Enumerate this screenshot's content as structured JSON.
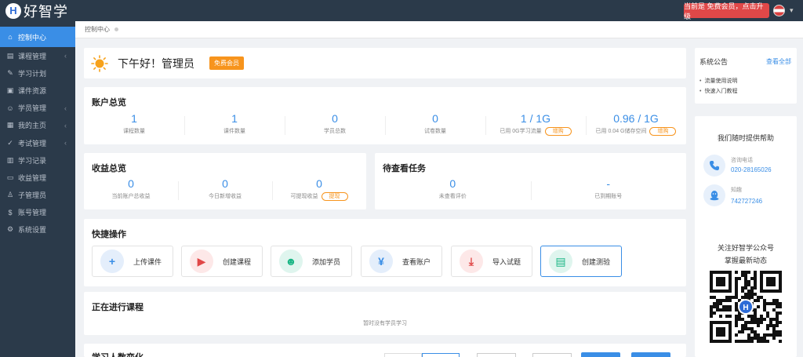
{
  "app": {
    "logo_mark": "H",
    "logo_text": "好智学",
    "upgrade_label": "当前是 免费会员，点击升级",
    "user_caret": "▾"
  },
  "sidebar": {
    "items": [
      {
        "label": "控制中心",
        "icon": "home-icon",
        "glyph": "⌂",
        "arrow": ""
      },
      {
        "label": "课程管理",
        "icon": "course-icon",
        "glyph": "▤",
        "arrow": "‹"
      },
      {
        "label": "学习计划",
        "icon": "plan-icon",
        "glyph": "✎",
        "arrow": ""
      },
      {
        "label": "课件资源",
        "icon": "resource-icon",
        "glyph": "▣",
        "arrow": ""
      },
      {
        "label": "学员管理",
        "icon": "students-icon",
        "glyph": "☺",
        "arrow": "‹"
      },
      {
        "label": "我的主页",
        "icon": "homepage-icon",
        "glyph": "▦",
        "arrow": "‹"
      },
      {
        "label": "考试管理",
        "icon": "exam-icon",
        "glyph": "✓",
        "arrow": "‹"
      },
      {
        "label": "学习记录",
        "icon": "record-icon",
        "glyph": "▥",
        "arrow": ""
      },
      {
        "label": "收益管理",
        "icon": "income-icon",
        "glyph": "▭",
        "arrow": ""
      },
      {
        "label": "子管理员",
        "icon": "subadmin-icon",
        "glyph": "♙",
        "arrow": ""
      },
      {
        "label": "账号管理",
        "icon": "account-icon",
        "glyph": "$",
        "arrow": ""
      },
      {
        "label": "系统设置",
        "icon": "settings-icon",
        "glyph": "⚙",
        "arrow": ""
      }
    ]
  },
  "breadcrumb": {
    "current": "控制中心"
  },
  "greeting": {
    "text": "下午好！管理员",
    "badge": "免费会员"
  },
  "account": {
    "title": "账户总览",
    "stats": [
      {
        "value": "1",
        "label": "课程数量",
        "pill": ""
      },
      {
        "value": "1",
        "label": "课件数量",
        "pill": ""
      },
      {
        "value": "0",
        "label": "学员总数",
        "pill": ""
      },
      {
        "value": "0",
        "label": "试卷数量",
        "pill": ""
      },
      {
        "value": "1 / 1G",
        "label": "已用 0G学习流量",
        "pill": "增购"
      },
      {
        "value": "0.96 / 1G",
        "label": "已用 0.04 G储存空间",
        "pill": "增购"
      }
    ]
  },
  "income": {
    "title": "收益总览",
    "stats": [
      {
        "value": "0",
        "label": "当前账户总收益",
        "pill": ""
      },
      {
        "value": "0",
        "label": "今日新增收益",
        "pill": ""
      },
      {
        "value": "0",
        "label": "可提现收益",
        "pill": "提现"
      }
    ]
  },
  "tasks": {
    "title": "待查看任务",
    "stats": [
      {
        "value": "0",
        "label": "未查看评价",
        "pill": ""
      },
      {
        "value": "-",
        "label": "已到期账号",
        "pill": ""
      }
    ]
  },
  "quick": {
    "title": "快捷操作",
    "buttons": [
      {
        "label": "上传课件",
        "icon": "plus-icon",
        "glyph": "+",
        "bg": "#e4eefb",
        "fg": "#3a8ee6"
      },
      {
        "label": "创建课程",
        "icon": "video-icon",
        "glyph": "▶",
        "bg": "#fde8e8",
        "fg": "#e04848"
      },
      {
        "label": "添加学员",
        "icon": "user-icon",
        "glyph": "☻",
        "bg": "#dff5ee",
        "fg": "#18b584"
      },
      {
        "label": "查看账户",
        "icon": "yen-icon",
        "glyph": "¥",
        "bg": "#e4eefb",
        "fg": "#3a8ee6"
      },
      {
        "label": "导入试题",
        "icon": "download-icon",
        "glyph": "⤓",
        "bg": "#fde8e8",
        "fg": "#e04848"
      },
      {
        "label": "创建测验",
        "icon": "doc-icon",
        "glyph": "▤",
        "bg": "#dff5ee",
        "fg": "#18b584"
      }
    ]
  },
  "ongoing": {
    "title": "正在进行课程",
    "empty": "暂时没有学员学习"
  },
  "trend": {
    "title": "学习人数变化"
  },
  "notice": {
    "title": "系统公告",
    "more": "查看全部",
    "items": [
      "流量使用说明",
      "快速入门教程"
    ]
  },
  "help": {
    "title": "我们随时提供帮助",
    "phone_label": "咨询电话",
    "phone": "020-28165026",
    "qq_label": "知趣",
    "qq": "742727246",
    "follow1": "关注好智学公众号",
    "follow2": "掌握最新动态",
    "qr_mark": "H"
  }
}
